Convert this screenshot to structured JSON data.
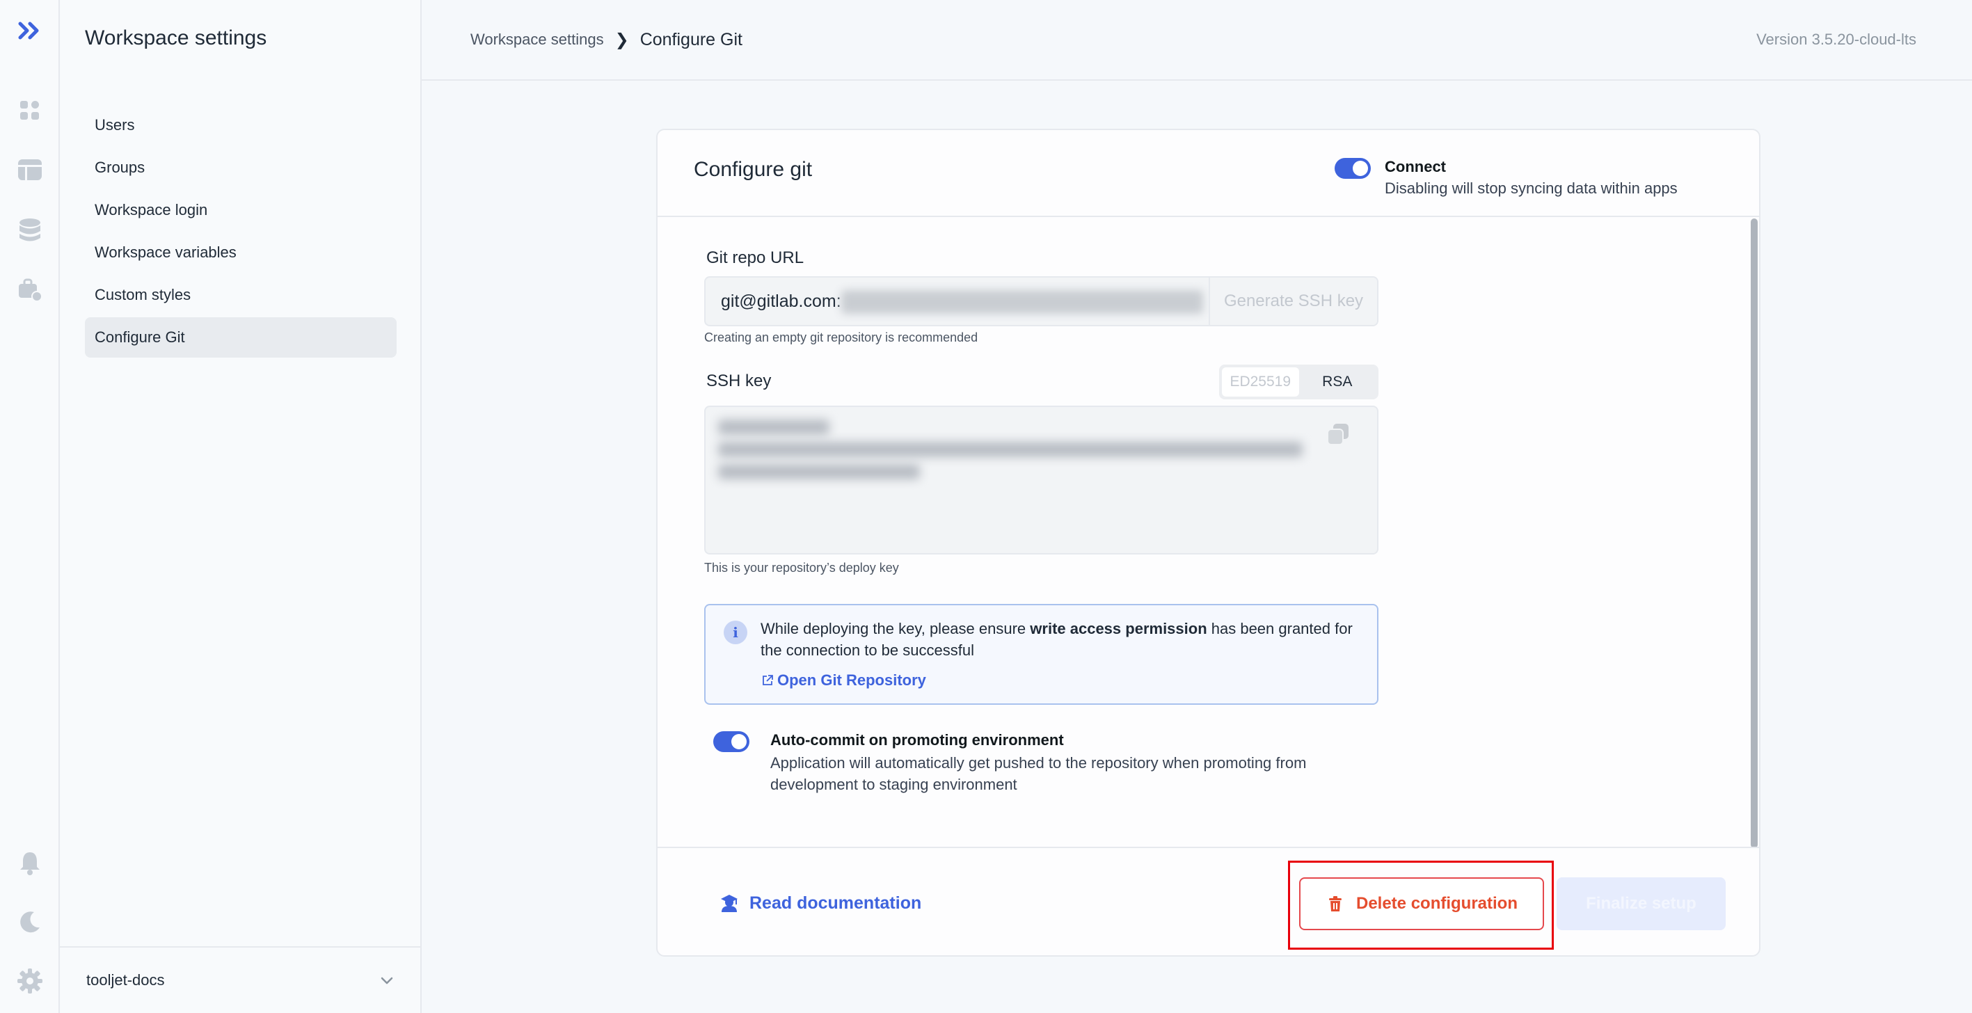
{
  "sidebar": {
    "title": "Workspace settings",
    "items": [
      {
        "label": "Users"
      },
      {
        "label": "Groups"
      },
      {
        "label": "Workspace login"
      },
      {
        "label": "Workspace variables"
      },
      {
        "label": "Custom styles"
      },
      {
        "label": "Configure Git",
        "active": true
      }
    ],
    "workspace": "tooljet-docs"
  },
  "rail": {
    "icons": [
      "logo-icon",
      "apps-icon",
      "table-icon",
      "database-icon",
      "plugins-icon",
      "bell-icon",
      "moon-icon",
      "gear-icon"
    ]
  },
  "header": {
    "breadcrumb_parent": "Workspace settings",
    "breadcrumb_sep": "❯",
    "breadcrumb_current": "Configure Git",
    "version": "Version 3.5.20-cloud-lts"
  },
  "card": {
    "title": "Configure git",
    "connect": {
      "label": "Connect",
      "description": "Disabling will stop syncing data within apps",
      "enabled": true
    },
    "repo": {
      "label": "Git repo URL",
      "value": "git@gitlab.com:",
      "generate_label": "Generate SSH key",
      "hint": "Creating an empty git repository is recommended"
    },
    "ssh": {
      "label": "SSH key",
      "types": [
        "ED25519",
        "RSA"
      ],
      "selected_type": "ED25519",
      "hint": "This is your repository’s deploy key"
    },
    "info": {
      "text_before": "While deploying the key, please ensure ",
      "text_bold": "write access permission",
      "text_after": " has been granted for the connection to be successful",
      "link": "Open Git Repository"
    },
    "auto_commit": {
      "label": "Auto-commit on promoting environment",
      "description": "Application will automatically get pushed to the repository when promoting from development to staging environment",
      "enabled": true
    },
    "footer": {
      "docs_label": "Read documentation",
      "delete_label": "Delete configuration",
      "finalize_label": "Finalize setup"
    }
  },
  "colors": {
    "accent": "#3e63dd",
    "danger": "#e54d2e",
    "highlight": "#e8000b"
  }
}
